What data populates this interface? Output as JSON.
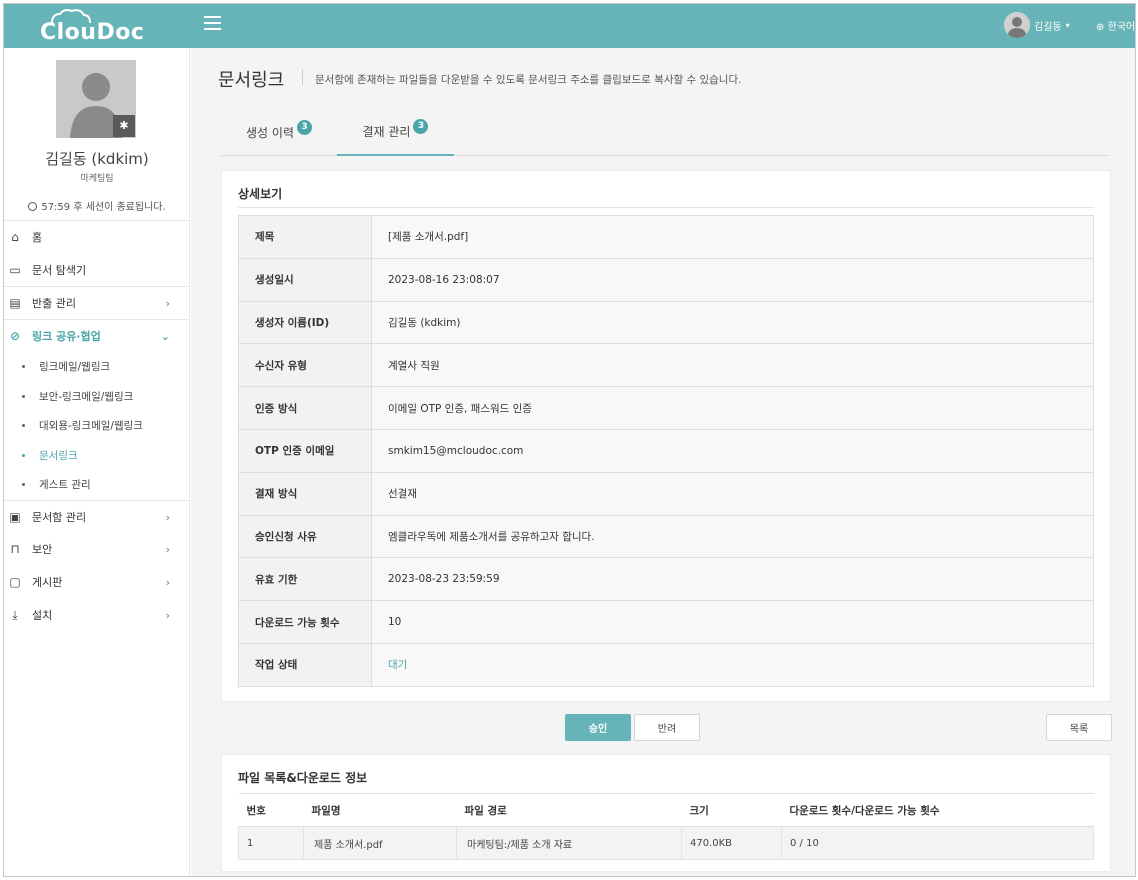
{
  "app": {
    "logo": "ClouDoc"
  },
  "header": {
    "user_name": "김길동",
    "caret": "▾",
    "language": "한국어"
  },
  "sidebar": {
    "profile_name": "김길동 (kdkim)",
    "team": "마케팅팀",
    "session_text": "57:59 후 세션이 종료됩니다.",
    "nav": [
      {
        "label": "홈"
      },
      {
        "label": "문서 탐색기"
      },
      {
        "label": "반출 관리"
      },
      {
        "label": "링크 공유·협업"
      },
      {
        "label": "문서함 관리"
      },
      {
        "label": "보안"
      },
      {
        "label": "게시판"
      },
      {
        "label": "설치"
      }
    ],
    "sub_items": [
      {
        "label": "링크메일/웹링크"
      },
      {
        "label": "보안-링크메일/웹링크"
      },
      {
        "label": "대외용-링크메일/웹링크"
      },
      {
        "label": "문서링크"
      },
      {
        "label": "게스트 관리"
      }
    ]
  },
  "page": {
    "title": "문서링크",
    "description": "문서함에 존재하는 파일들을 다운받을 수 있도록 문서링크 주소를 클립보드로 복사할 수 있습니다."
  },
  "tabs": [
    {
      "label": "생성 이력",
      "badge": "3"
    },
    {
      "label": "결재 관리",
      "badge": "3"
    }
  ],
  "detail": {
    "title": "상세보기",
    "rows": [
      {
        "label": "제목",
        "value": "[제품 소개서.pdf]"
      },
      {
        "label": "생성일시",
        "value": "2023-08-16 23:08:07"
      },
      {
        "label": "생성자 이름(ID)",
        "value": "김길동 (kdkim)"
      },
      {
        "label": "수신자 유형",
        "value": "계열사 직원"
      },
      {
        "label": "인증 방식",
        "value": "이메일 OTP 인증, 패스워드 인증"
      },
      {
        "label": "OTP 인증 이메일",
        "value": "smkim15@mcloudoc.com"
      },
      {
        "label": "결재 방식",
        "value": "선결재"
      },
      {
        "label": "승인신청 사유",
        "value": "엠클라우독에 제품소개서를 공유하고자 합니다."
      },
      {
        "label": "유효 기한",
        "value": "2023-08-23 23:59:59"
      },
      {
        "label": "다운로드 가능 횟수",
        "value": "10"
      },
      {
        "label": "작업 상태",
        "value": "대기"
      }
    ]
  },
  "actions": {
    "approve": "승인",
    "reject": "반려",
    "list": "목록"
  },
  "files": {
    "title": "파일 목록&다운로드 정보",
    "columns": [
      "번호",
      "파일명",
      "파일 경로",
      "크기",
      "다운로드 횟수/다운로드 가능 횟수"
    ],
    "rows": [
      [
        "1",
        "제품 소개서.pdf",
        "마케팅팀:/제품 소개 자료",
        "470.0KB",
        "0 / 10"
      ]
    ]
  }
}
